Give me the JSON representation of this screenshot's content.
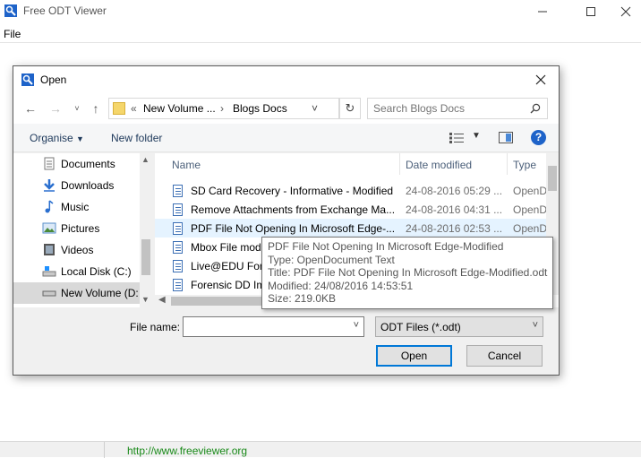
{
  "app": {
    "title": "Free ODT Viewer",
    "menu": [
      "File"
    ],
    "status_link": "http://www.freeviewer.org"
  },
  "dialog": {
    "title": "Open",
    "address": {
      "crumbs": [
        "New Volume ...",
        "Blogs Docs"
      ],
      "separator": "«",
      "arrow": "›"
    },
    "search_placeholder": "Search Blogs Docs",
    "toolbar": {
      "organise": "Organise",
      "new_folder": "New folder"
    },
    "nav_items": [
      {
        "label": "Documents",
        "icon": "documents-icon"
      },
      {
        "label": "Downloads",
        "icon": "downloads-icon"
      },
      {
        "label": "Music",
        "icon": "music-icon"
      },
      {
        "label": "Pictures",
        "icon": "pictures-icon"
      },
      {
        "label": "Videos",
        "icon": "videos-icon"
      },
      {
        "label": "Local Disk (C:)",
        "icon": "local-disk-icon"
      },
      {
        "label": "New Volume (D:",
        "icon": "drive-icon",
        "selected": true
      }
    ],
    "columns": {
      "name": "Name",
      "date": "Date modified",
      "type": "Type"
    },
    "files": [
      {
        "name": "SD Card Recovery - Informative - Modified",
        "date": "24-08-2016 05:29 ...",
        "type": "OpenD"
      },
      {
        "name": "Remove Attachments from Exchange Ma...",
        "date": "24-08-2016 04:31 ...",
        "type": "OpenD"
      },
      {
        "name": "PDF File Not Opening In Microsoft Edge-...",
        "date": "24-08-2016 02:53 ...",
        "type": "OpenD",
        "highlighted": true
      },
      {
        "name": "Mbox File mod",
        "date": "",
        "type": ""
      },
      {
        "name": "Live@EDU Fore",
        "date": "",
        "type": ""
      },
      {
        "name": "Forensic DD Im",
        "date": "",
        "type": ""
      }
    ],
    "tooltip": [
      "PDF File Not Opening In Microsoft Edge-Modified",
      "Type: OpenDocument Text",
      "Title: PDF File Not Opening In Microsoft Edge-Modified.odt",
      "Modified: 24/08/2016 14:53:51",
      "Size: 219.0KB"
    ],
    "file_name_label": "File name:",
    "file_name_value": "",
    "file_type": "ODT Files (*.odt)",
    "open_label": "Open",
    "cancel_label": "Cancel"
  }
}
